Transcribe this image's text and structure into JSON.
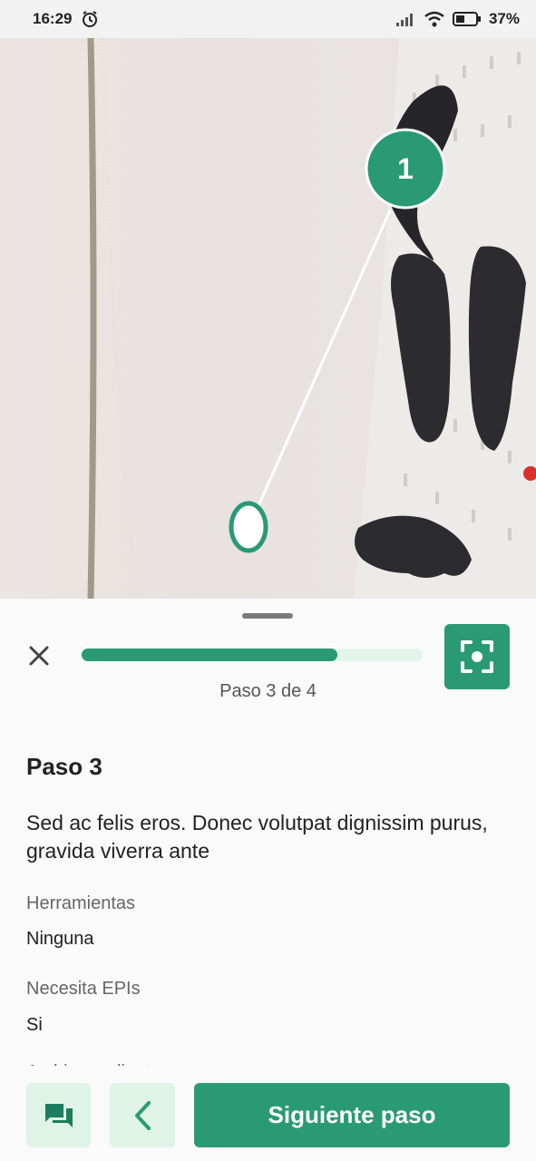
{
  "status_bar": {
    "time": "16:29",
    "battery": "37%",
    "icons": [
      "alarm-icon",
      "signal-icon",
      "wifi-icon",
      "battery-icon"
    ]
  },
  "camera_view": {
    "marker_label": "1",
    "accent_color": "#2a9a74"
  },
  "sheet": {
    "progress": {
      "current_step": 3,
      "total_steps": 4,
      "fraction": 0.75,
      "label": "Paso 3 de 4"
    },
    "step_title": "Paso 3",
    "step_description": "Sed ac felis eros. Donec volutpat dignissim purus, gravida viverra ante",
    "fields": [
      {
        "label": "Herramientas",
        "value": "Ninguna"
      },
      {
        "label": "Necesita EPIs",
        "value": "Si"
      }
    ],
    "partial_label": "Archivos adjuntos"
  },
  "actions": {
    "next_label": "Siguiente paso"
  },
  "colors": {
    "primary": "#2a9a74",
    "primary_light": "#dff3e6"
  }
}
